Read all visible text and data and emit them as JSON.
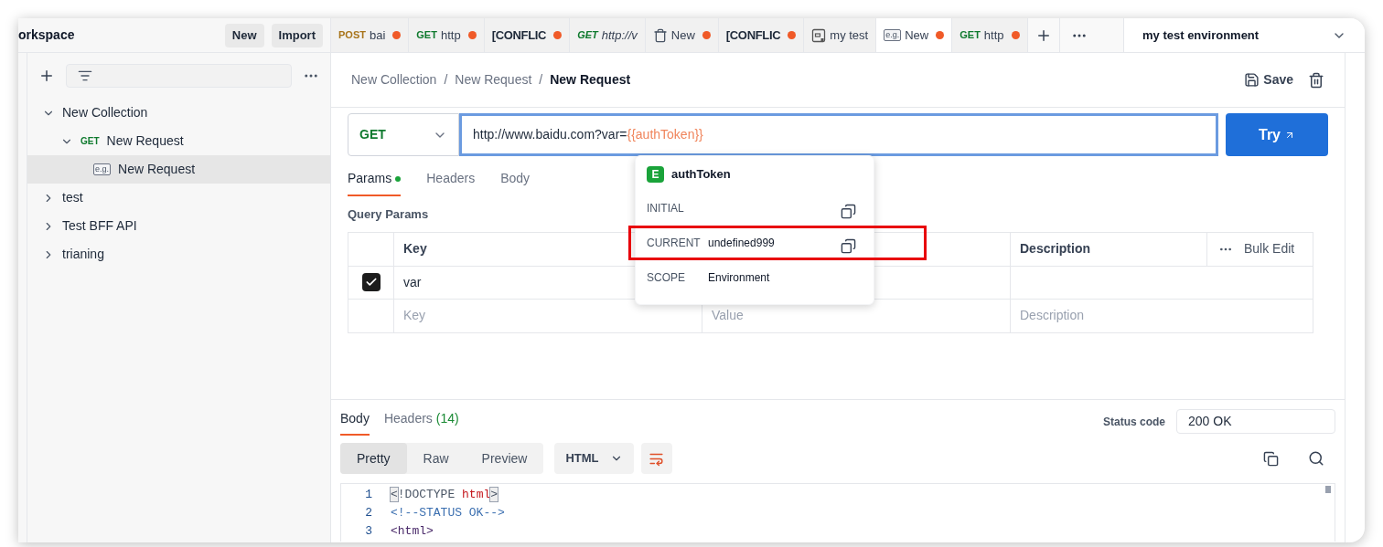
{
  "workspace": {
    "title": "orkspace",
    "buttons": [
      "New",
      "Import"
    ]
  },
  "tabs": [
    {
      "kind": "request",
      "method": "POST",
      "color": "#a8741a",
      "label": "bai",
      "preview": false,
      "unsaved": true,
      "selected": false
    },
    {
      "kind": "request",
      "method": "GET",
      "color": "#0f7a2e",
      "label": "http",
      "preview": false,
      "unsaved": true,
      "selected": false
    },
    {
      "kind": "plain",
      "label": "[CONFLIC",
      "preview": false,
      "unsaved": true,
      "selected": false
    },
    {
      "kind": "request",
      "method": "GET",
      "color": "#0f7a2e",
      "label": "http://v",
      "preview": true,
      "unsaved": false,
      "selected": false
    },
    {
      "kind": "collection",
      "label": "New",
      "preview": false,
      "unsaved": true,
      "selected": false
    },
    {
      "kind": "plain",
      "label": "[CONFLIC",
      "preview": false,
      "unsaved": true,
      "selected": false
    },
    {
      "kind": "environment",
      "label": "my test",
      "preview": false,
      "unsaved": false,
      "selected": false
    },
    {
      "kind": "example",
      "icon_text": "e.g.",
      "label": "New",
      "preview": false,
      "unsaved": true,
      "selected": true
    },
    {
      "kind": "request",
      "method": "GET",
      "color": "#0f7a2e",
      "label": "http",
      "preview": false,
      "unsaved": true,
      "selected": false
    }
  ],
  "environment": {
    "name": "my test environment"
  },
  "sidebar": {
    "items": [
      {
        "kind": "collection",
        "label": "New Collection",
        "expanded": true,
        "selected": false,
        "children": [
          {
            "kind": "request",
            "method": "GET",
            "label": "New Request",
            "expanded": true,
            "selected": false,
            "children": [
              {
                "kind": "example",
                "icon_text": "e.g.",
                "label": "New Request",
                "selected": true
              }
            ]
          }
        ]
      },
      {
        "kind": "collection",
        "label": "test",
        "expanded": false,
        "selected": false
      },
      {
        "kind": "collection",
        "label": "Test BFF API",
        "expanded": false,
        "selected": false
      },
      {
        "kind": "collection",
        "label": "trianing",
        "expanded": false,
        "selected": false
      }
    ]
  },
  "breadcrumb": {
    "separator": "/",
    "items": [
      "New Collection",
      "New Request",
      "New Request"
    ]
  },
  "save": "Save",
  "request": {
    "method": "GET",
    "url": "http://www.baidu.com?var=",
    "variable": "{{authToken}}",
    "send": "Try"
  },
  "request_tabs": [
    {
      "label": "Params",
      "dot": true,
      "selected": true
    },
    {
      "label": "Headers",
      "dot": false,
      "selected": false
    },
    {
      "label": "Body",
      "dot": false,
      "selected": false
    }
  ],
  "query_params": {
    "title": "Query Params",
    "header": {
      "key": "Key",
      "description": "Description",
      "bulk_edit": "Bulk Edit"
    },
    "rows": [
      {
        "checked": true,
        "key": "var"
      }
    ],
    "new_row": {
      "key": {
        "placeholder": "Key"
      },
      "value": {
        "placeholder": "Value"
      },
      "description": {
        "placeholder": "Description"
      }
    }
  },
  "popover": {
    "badge": "E",
    "name": "authToken",
    "fields": [
      {
        "label": "INITIAL",
        "copyable": true,
        "highlighted": false
      },
      {
        "label": "CURRENT",
        "value": "undefined999",
        "copyable": true,
        "highlighted": true
      },
      {
        "label": "SCOPE",
        "value": "Environment",
        "copyable": false,
        "highlighted": false
      }
    ]
  },
  "response": {
    "tabs": [
      {
        "label": "Body",
        "selected": true
      },
      {
        "label": "Headers",
        "count": "(14)",
        "selected": false
      }
    ],
    "status_label": "Status code",
    "status": "200 OK",
    "views": [
      {
        "label": "Pretty",
        "selected": true
      },
      {
        "label": "Raw",
        "selected": false
      },
      {
        "label": "Preview",
        "selected": false
      }
    ],
    "format": "HTML",
    "lines": [
      {
        "number": "1",
        "tokens": [
          {
            "kind": "bracket",
            "text": "<"
          },
          {
            "kind": "plain",
            "text": "!DOCTYPE "
          },
          {
            "kind": "tag",
            "text": "html"
          },
          {
            "kind": "bracket",
            "text": ">"
          }
        ]
      },
      {
        "number": "2",
        "tokens": [
          {
            "kind": "comment",
            "text": "<!--STATUS OK-->"
          }
        ]
      },
      {
        "number": "3",
        "tokens": [
          {
            "kind": "tag-dark",
            "text": "<html>"
          }
        ]
      }
    ]
  }
}
